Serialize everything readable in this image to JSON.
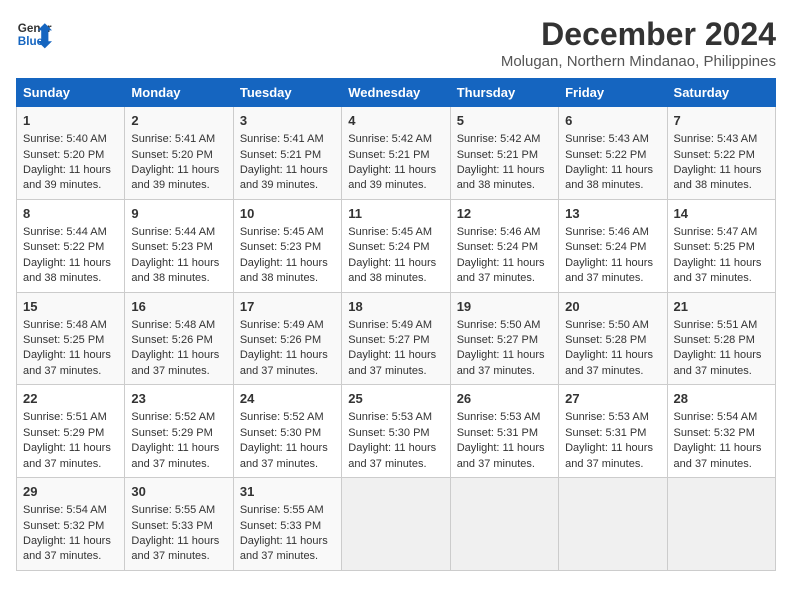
{
  "logo": {
    "line1": "General",
    "line2": "Blue"
  },
  "title": "December 2024",
  "location": "Molugan, Northern Mindanao, Philippines",
  "days_of_week": [
    "Sunday",
    "Monday",
    "Tuesday",
    "Wednesday",
    "Thursday",
    "Friday",
    "Saturday"
  ],
  "weeks": [
    [
      {
        "day": "1",
        "rise": "5:40 AM",
        "set": "5:20 PM",
        "daylight": "11 hours and 39 minutes."
      },
      {
        "day": "2",
        "rise": "5:41 AM",
        "set": "5:20 PM",
        "daylight": "11 hours and 39 minutes."
      },
      {
        "day": "3",
        "rise": "5:41 AM",
        "set": "5:21 PM",
        "daylight": "11 hours and 39 minutes."
      },
      {
        "day": "4",
        "rise": "5:42 AM",
        "set": "5:21 PM",
        "daylight": "11 hours and 39 minutes."
      },
      {
        "day": "5",
        "rise": "5:42 AM",
        "set": "5:21 PM",
        "daylight": "11 hours and 38 minutes."
      },
      {
        "day": "6",
        "rise": "5:43 AM",
        "set": "5:22 PM",
        "daylight": "11 hours and 38 minutes."
      },
      {
        "day": "7",
        "rise": "5:43 AM",
        "set": "5:22 PM",
        "daylight": "11 hours and 38 minutes."
      }
    ],
    [
      {
        "day": "8",
        "rise": "5:44 AM",
        "set": "5:22 PM",
        "daylight": "11 hours and 38 minutes."
      },
      {
        "day": "9",
        "rise": "5:44 AM",
        "set": "5:23 PM",
        "daylight": "11 hours and 38 minutes."
      },
      {
        "day": "10",
        "rise": "5:45 AM",
        "set": "5:23 PM",
        "daylight": "11 hours and 38 minutes."
      },
      {
        "day": "11",
        "rise": "5:45 AM",
        "set": "5:24 PM",
        "daylight": "11 hours and 38 minutes."
      },
      {
        "day": "12",
        "rise": "5:46 AM",
        "set": "5:24 PM",
        "daylight": "11 hours and 37 minutes."
      },
      {
        "day": "13",
        "rise": "5:46 AM",
        "set": "5:24 PM",
        "daylight": "11 hours and 37 minutes."
      },
      {
        "day": "14",
        "rise": "5:47 AM",
        "set": "5:25 PM",
        "daylight": "11 hours and 37 minutes."
      }
    ],
    [
      {
        "day": "15",
        "rise": "5:48 AM",
        "set": "5:25 PM",
        "daylight": "11 hours and 37 minutes."
      },
      {
        "day": "16",
        "rise": "5:48 AM",
        "set": "5:26 PM",
        "daylight": "11 hours and 37 minutes."
      },
      {
        "day": "17",
        "rise": "5:49 AM",
        "set": "5:26 PM",
        "daylight": "11 hours and 37 minutes."
      },
      {
        "day": "18",
        "rise": "5:49 AM",
        "set": "5:27 PM",
        "daylight": "11 hours and 37 minutes."
      },
      {
        "day": "19",
        "rise": "5:50 AM",
        "set": "5:27 PM",
        "daylight": "11 hours and 37 minutes."
      },
      {
        "day": "20",
        "rise": "5:50 AM",
        "set": "5:28 PM",
        "daylight": "11 hours and 37 minutes."
      },
      {
        "day": "21",
        "rise": "5:51 AM",
        "set": "5:28 PM",
        "daylight": "11 hours and 37 minutes."
      }
    ],
    [
      {
        "day": "22",
        "rise": "5:51 AM",
        "set": "5:29 PM",
        "daylight": "11 hours and 37 minutes."
      },
      {
        "day": "23",
        "rise": "5:52 AM",
        "set": "5:29 PM",
        "daylight": "11 hours and 37 minutes."
      },
      {
        "day": "24",
        "rise": "5:52 AM",
        "set": "5:30 PM",
        "daylight": "11 hours and 37 minutes."
      },
      {
        "day": "25",
        "rise": "5:53 AM",
        "set": "5:30 PM",
        "daylight": "11 hours and 37 minutes."
      },
      {
        "day": "26",
        "rise": "5:53 AM",
        "set": "5:31 PM",
        "daylight": "11 hours and 37 minutes."
      },
      {
        "day": "27",
        "rise": "5:53 AM",
        "set": "5:31 PM",
        "daylight": "11 hours and 37 minutes."
      },
      {
        "day": "28",
        "rise": "5:54 AM",
        "set": "5:32 PM",
        "daylight": "11 hours and 37 minutes."
      }
    ],
    [
      {
        "day": "29",
        "rise": "5:54 AM",
        "set": "5:32 PM",
        "daylight": "11 hours and 37 minutes."
      },
      {
        "day": "30",
        "rise": "5:55 AM",
        "set": "5:33 PM",
        "daylight": "11 hours and 37 minutes."
      },
      {
        "day": "31",
        "rise": "5:55 AM",
        "set": "5:33 PM",
        "daylight": "11 hours and 37 minutes."
      },
      null,
      null,
      null,
      null
    ]
  ],
  "labels": {
    "sunrise": "Sunrise:",
    "sunset": "Sunset:",
    "daylight": "Daylight:"
  }
}
